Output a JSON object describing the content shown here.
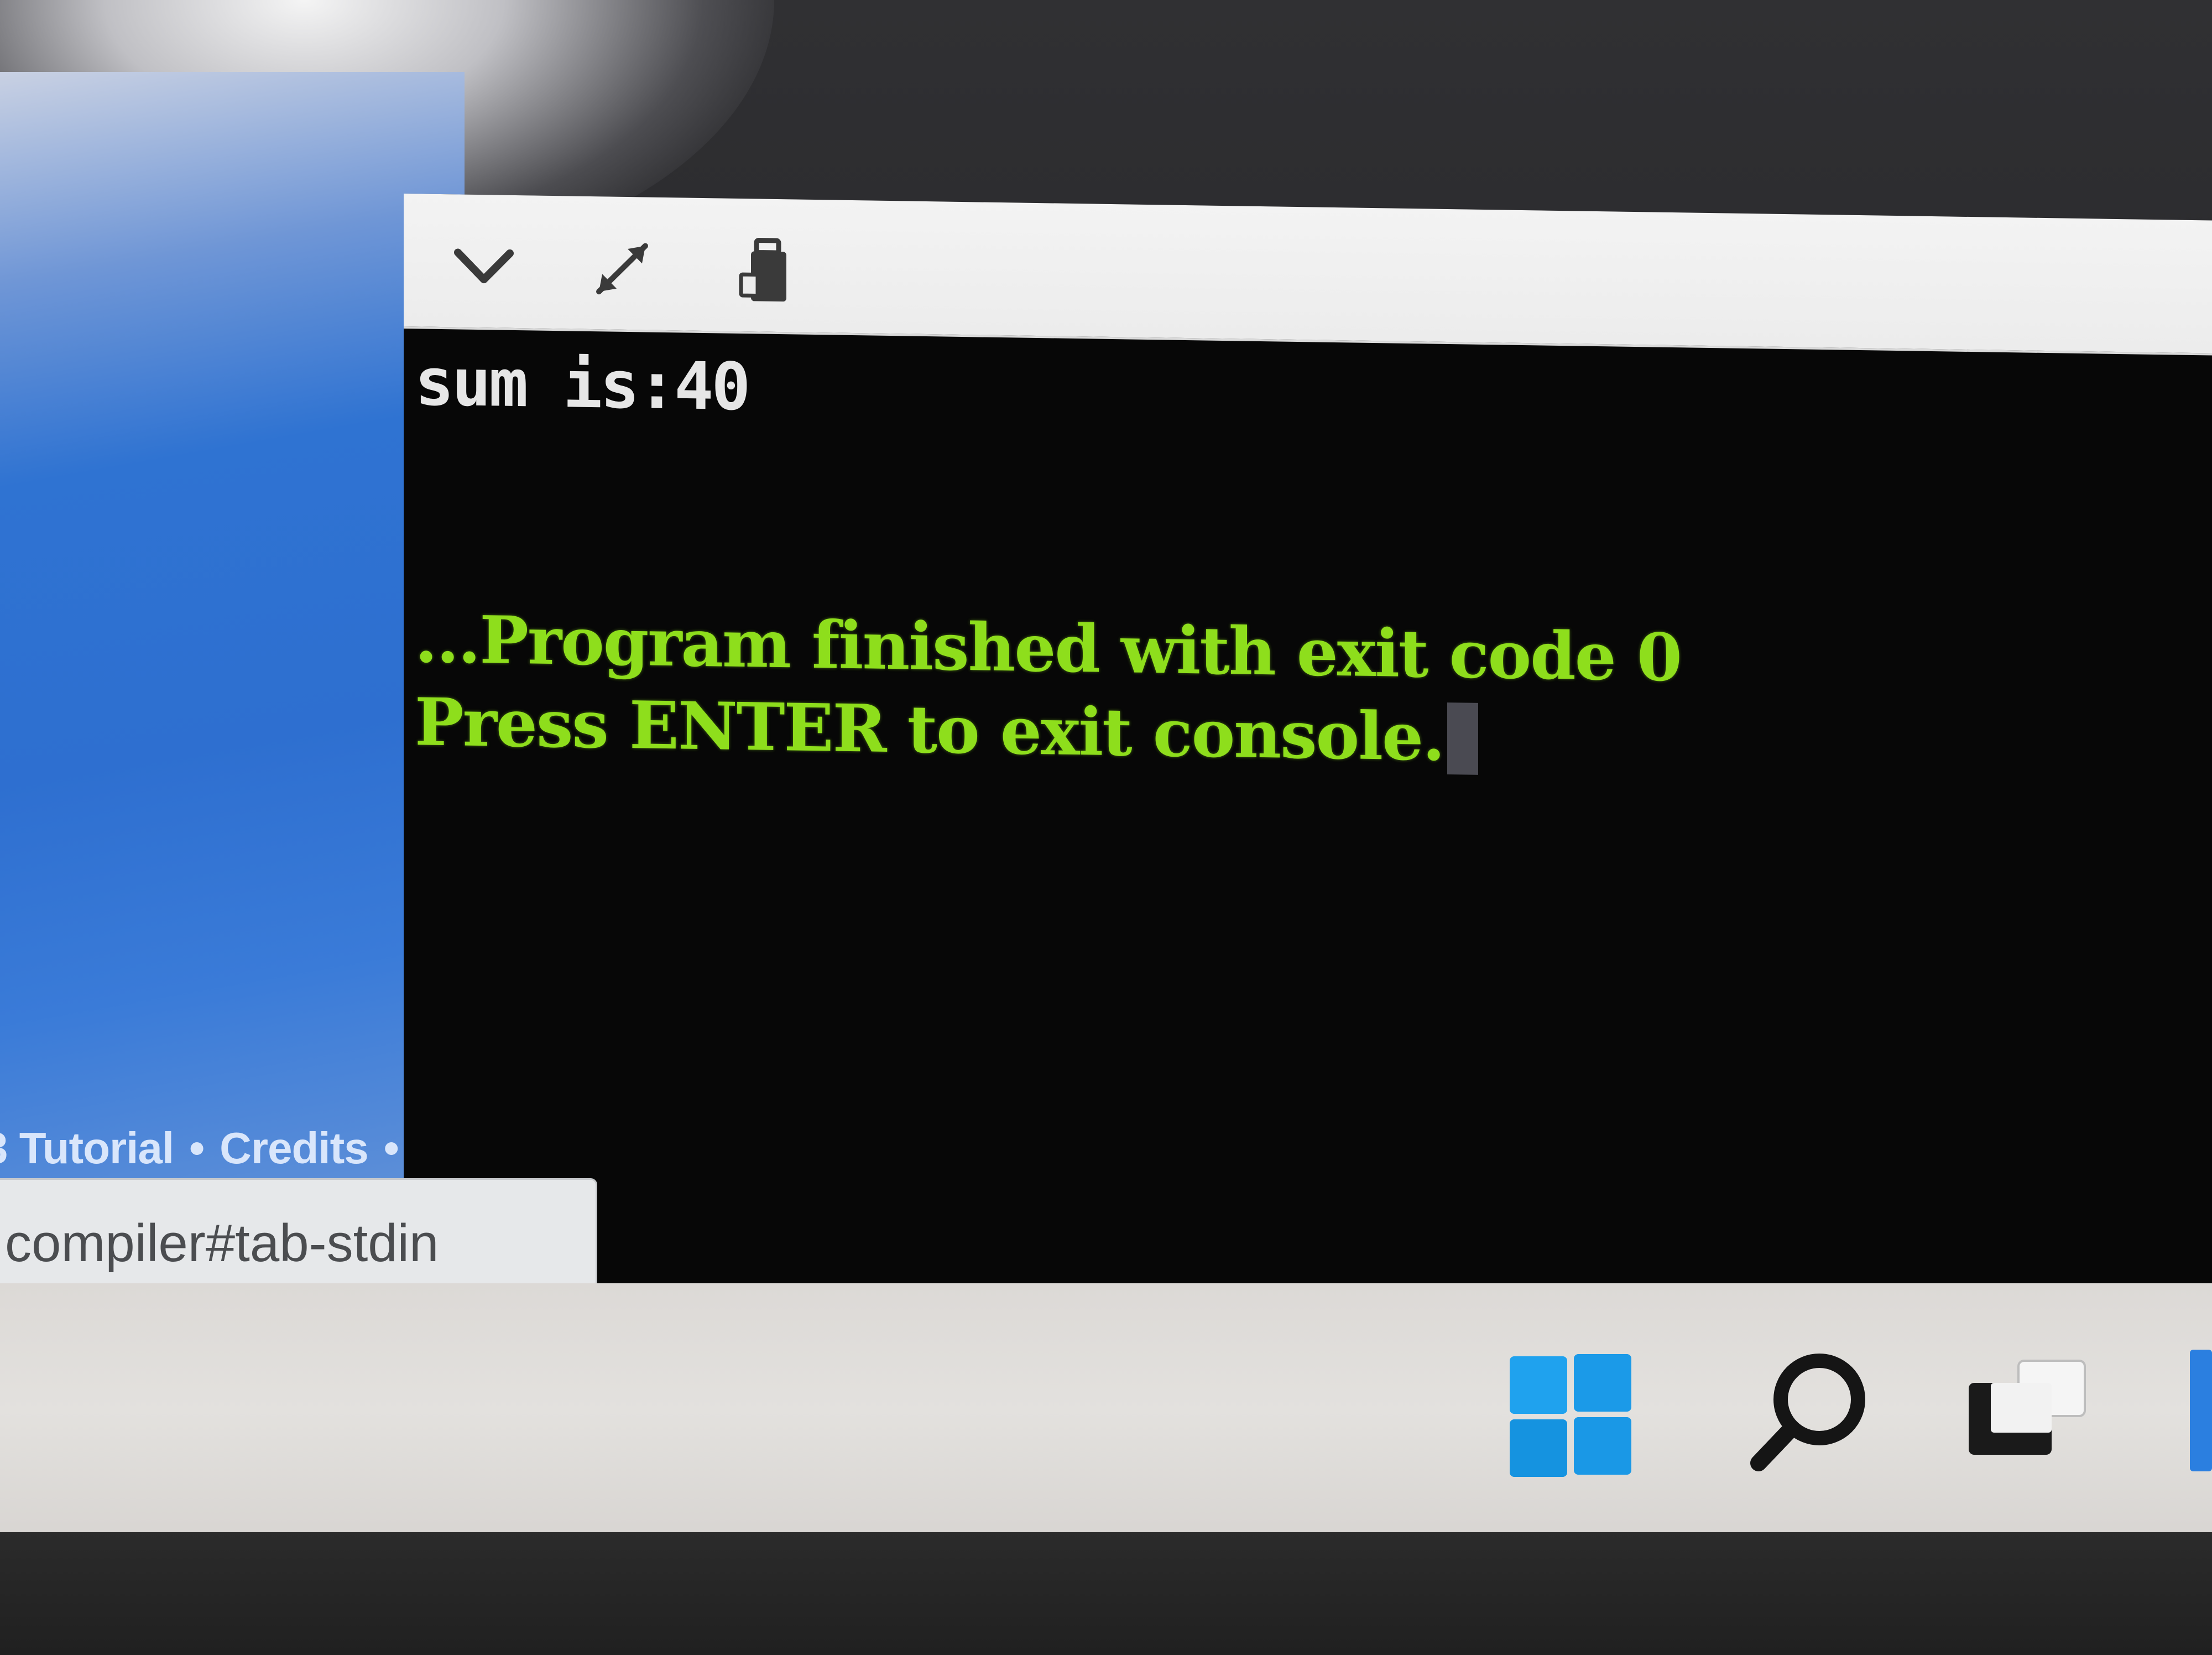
{
  "browser_page": {
    "footer_links": [
      "3 Tutorial",
      "Credits"
    ],
    "footer_separator": "•"
  },
  "status_url": "compiler#tab-stdin",
  "console": {
    "toolbar": {
      "icons": [
        "chevron-down-icon",
        "expand-icon",
        "copy-icon"
      ]
    },
    "output_lines": {
      "sum": "sum is:40",
      "finished": "...Program finished with exit code 0",
      "press_enter": "Press ENTER to exit console."
    },
    "colors": {
      "background": "#070707",
      "stdout_text": "#e6e6e6",
      "status_text": "#8ede1c"
    }
  },
  "taskbar": {
    "icons": [
      "windows-start-icon",
      "search-icon",
      "task-view-icon"
    ],
    "colors": {
      "start_blue": "#1fa2ee",
      "background": "#dedbd8"
    }
  }
}
